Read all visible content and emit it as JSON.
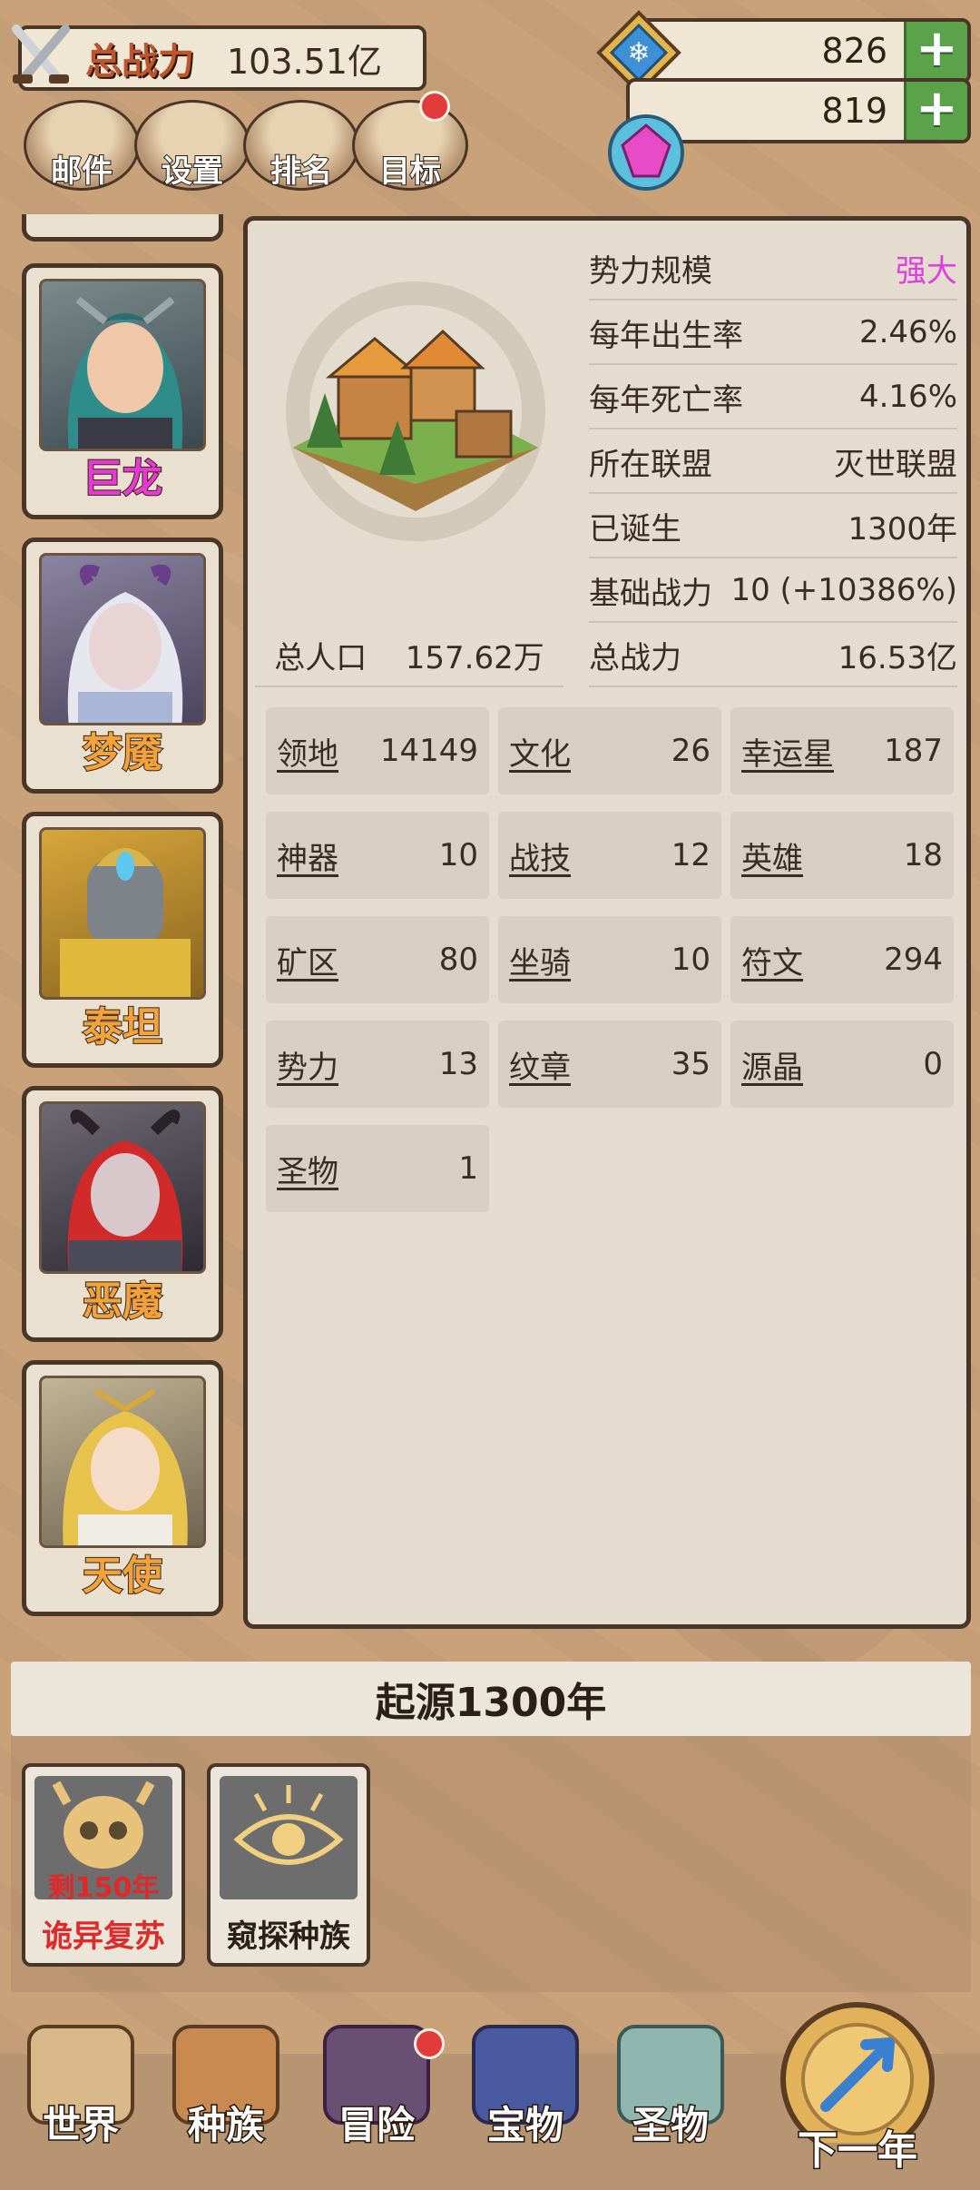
{
  "top": {
    "power_label": "总战力",
    "power_value": "103.51亿",
    "resource1_value": "826",
    "resource2_value": "819",
    "menu": [
      {
        "label": "邮件"
      },
      {
        "label": "设置"
      },
      {
        "label": "排名"
      },
      {
        "label": "目标"
      }
    ]
  },
  "heroes": [
    {
      "name": "巨龙",
      "name_color": "#e53bd4"
    },
    {
      "name": "梦魇",
      "name_color": "#f2a23a"
    },
    {
      "name": "泰坦",
      "name_color": "#f2a23a"
    },
    {
      "name": "恶魔",
      "name_color": "#f2a23a"
    },
    {
      "name": "天使",
      "name_color": "#f2a23a"
    }
  ],
  "panel": {
    "stats": [
      {
        "label": "势力规模",
        "value": "强大"
      },
      {
        "label": "每年出生率",
        "value": "2.46%"
      },
      {
        "label": "每年死亡率",
        "value": "4.16%"
      },
      {
        "label": "所在联盟",
        "value": "灭世联盟"
      },
      {
        "label": "已诞生",
        "value": "1300年"
      },
      {
        "label": "基础战力",
        "value": "10 (+10386%)"
      },
      {
        "label": "总战力",
        "value": "16.53亿"
      }
    ],
    "population_label": "总人口",
    "population_value": "157.62万",
    "grid": [
      {
        "label": "领地",
        "value": "14149"
      },
      {
        "label": "文化",
        "value": "26"
      },
      {
        "label": "幸运星",
        "value": "187"
      },
      {
        "label": "神器",
        "value": "10"
      },
      {
        "label": "战技",
        "value": "12"
      },
      {
        "label": "英雄",
        "value": "18"
      },
      {
        "label": "矿区",
        "value": "80"
      },
      {
        "label": "坐骑",
        "value": "10"
      },
      {
        "label": "符文",
        "value": "294"
      },
      {
        "label": "势力",
        "value": "13"
      },
      {
        "label": "纹章",
        "value": "35"
      },
      {
        "label": "源晶",
        "value": "0"
      },
      {
        "label": "圣物",
        "value": "1"
      }
    ],
    "highlight_color": "#e040e0"
  },
  "origin": {
    "title": "起源1300年",
    "events": [
      {
        "sub": "剩150年",
        "label": "诡异复苏",
        "label_color": "#e02a2a"
      },
      {
        "label": "窥探种族",
        "label_color": "#2a2018"
      }
    ]
  },
  "nav": [
    {
      "label": "世界"
    },
    {
      "label": "种族"
    },
    {
      "label": "冒险"
    },
    {
      "label": "宝物"
    },
    {
      "label": "圣物"
    },
    {
      "label": "下一年"
    }
  ]
}
